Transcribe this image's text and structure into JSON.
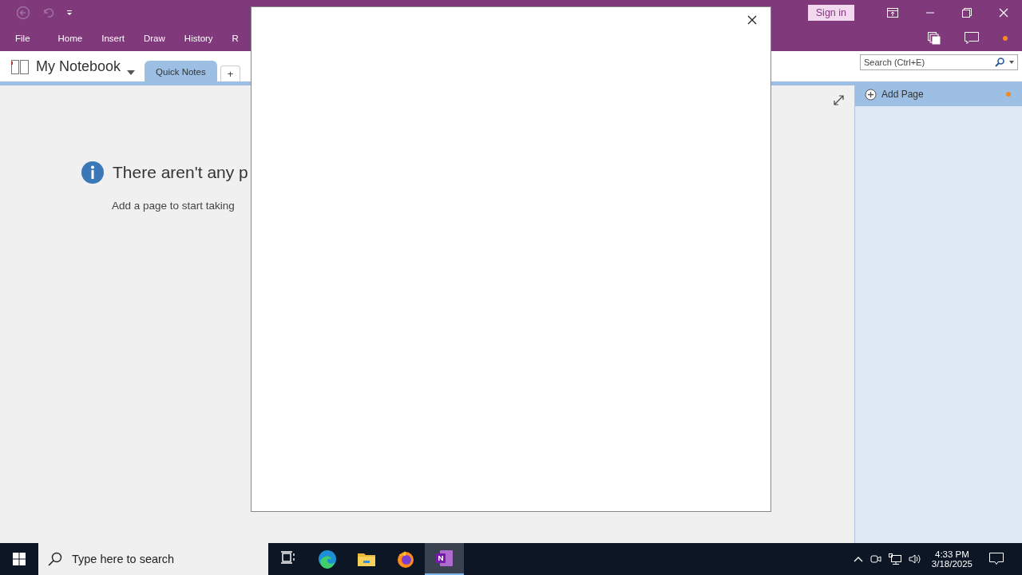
{
  "title_bar": {
    "sign_in": "Sign in"
  },
  "ribbon_tabs": [
    {
      "label": "File"
    },
    {
      "label": "Home"
    },
    {
      "label": "Insert"
    },
    {
      "label": "Draw"
    },
    {
      "label": "History"
    },
    {
      "label": "R"
    }
  ],
  "notebook": {
    "name": "My Notebook"
  },
  "sections": [
    {
      "label": "Quick Notes",
      "selected": true
    }
  ],
  "add_section": "+",
  "search": {
    "placeholder": "Search (Ctrl+E)"
  },
  "page_pane": {
    "add_page": "Add Page"
  },
  "empty_message": {
    "title": "There aren't any p",
    "hint": "Add a page to start taking"
  },
  "taskbar": {
    "search_placeholder": "Type here to search",
    "apps": [
      {
        "kind": "taskview",
        "selected": false
      },
      {
        "kind": "edge",
        "selected": false
      },
      {
        "kind": "folder",
        "selected": false
      },
      {
        "kind": "firefox",
        "selected": false
      },
      {
        "kind": "onenote",
        "selected": true
      }
    ],
    "time": "4:33 PM",
    "date": "3/18/2025"
  }
}
